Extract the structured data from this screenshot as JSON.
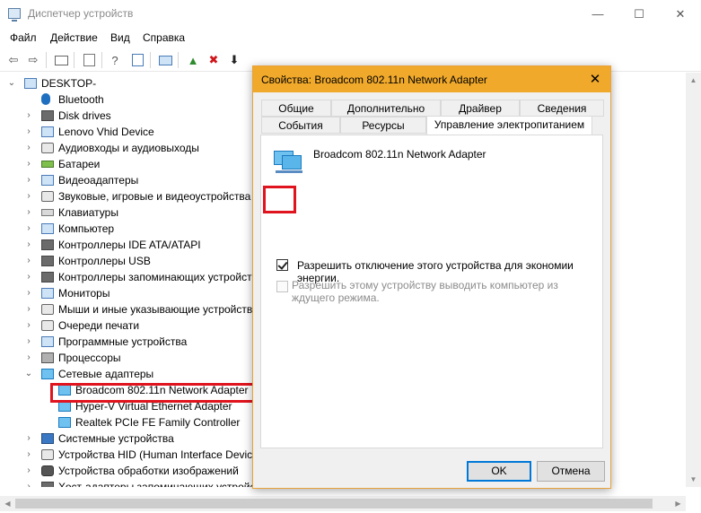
{
  "window": {
    "title": "Диспетчер устройств",
    "controls": {
      "minimize": "—",
      "maximize": "☐",
      "close": "✕"
    }
  },
  "menu": [
    "Файл",
    "Действие",
    "Вид",
    "Справка"
  ],
  "toolbar": {
    "icons": [
      "back-arrow-icon",
      "forward-arrow-icon",
      "properties-icon",
      "document-icon",
      "help-icon",
      "display-icon",
      "monitor-icon",
      "add-driver-icon",
      "remove-icon",
      "download-icon"
    ],
    "glyphs": {
      "back": "⇦",
      "forward": "⇨",
      "help": "?",
      "remove": "✖",
      "download": "⬇",
      "add": "▲"
    }
  },
  "tree": {
    "root": "DESKTOP-",
    "items": [
      {
        "label": "Bluetooth",
        "icon": "bluetooth-icon"
      },
      {
        "label": "Disk drives",
        "icon": "disk-icon"
      },
      {
        "label": "Lenovo Vhid Device",
        "icon": "device-icon"
      },
      {
        "label": "Аудиовходы и аудиовыходы",
        "icon": "audio-icon"
      },
      {
        "label": "Батареи",
        "icon": "battery-icon"
      },
      {
        "label": "Видеоадаптеры",
        "icon": "display-adapter-icon"
      },
      {
        "label": "Звуковые, игровые и видеоустройства",
        "icon": "sound-icon"
      },
      {
        "label": "Клавиатуры",
        "icon": "keyboard-icon"
      },
      {
        "label": "Компьютер",
        "icon": "computer-icon"
      },
      {
        "label": "Контроллеры IDE ATA/ATAPI",
        "icon": "ide-icon"
      },
      {
        "label": "Контроллеры USB",
        "icon": "usb-icon"
      },
      {
        "label": "Контроллеры запоминающих устройств",
        "icon": "storage-icon"
      },
      {
        "label": "Мониторы",
        "icon": "monitor-icon"
      },
      {
        "label": "Мыши и иные указывающие устройства",
        "icon": "mouse-icon"
      },
      {
        "label": "Очереди печати",
        "icon": "printer-icon"
      },
      {
        "label": "Программные устройства",
        "icon": "software-icon"
      },
      {
        "label": "Процессоры",
        "icon": "cpu-icon"
      },
      {
        "label": "Сетевые адаптеры",
        "icon": "network-icon"
      },
      {
        "label": "Broadcom 802.11n Network Adapter",
        "icon": "network-adapter-icon"
      },
      {
        "label": "Hyper-V Virtual Ethernet Adapter",
        "icon": "network-adapter-icon"
      },
      {
        "label": "Realtek PCIe FE Family Controller",
        "icon": "network-adapter-icon"
      },
      {
        "label": "Системные устройства",
        "icon": "system-icon"
      },
      {
        "label": "Устройства HID (Human Interface Devices)",
        "icon": "hid-icon"
      },
      {
        "label": "Устройства обработки изображений",
        "icon": "camera-icon"
      },
      {
        "label": "Хост-адаптеры запоминающих устройств",
        "icon": "storage-icon"
      }
    ],
    "arrows": {
      "collapsed": "›",
      "expanded": "⌄"
    }
  },
  "dialog": {
    "title": "Свойства: Broadcom 802.11n Network Adapter",
    "close": "✕",
    "tabs_row1": [
      "Общие",
      "Дополнительно",
      "Драйвер",
      "Сведения"
    ],
    "tabs_row2": [
      "События",
      "Ресурсы",
      "Управление электропитанием"
    ],
    "device_name": "Broadcom 802.11n Network Adapter",
    "option1": "Разрешить отключение этого устройства для экономии энергии.",
    "option2": "Разрешить этому устройству выводить компьютер из ждущего режима.",
    "ok": "OK",
    "cancel": "Отмена"
  },
  "colors": {
    "dialog_title": "#f0a92a",
    "highlight": "#e0141e",
    "accent": "#0078d7"
  }
}
